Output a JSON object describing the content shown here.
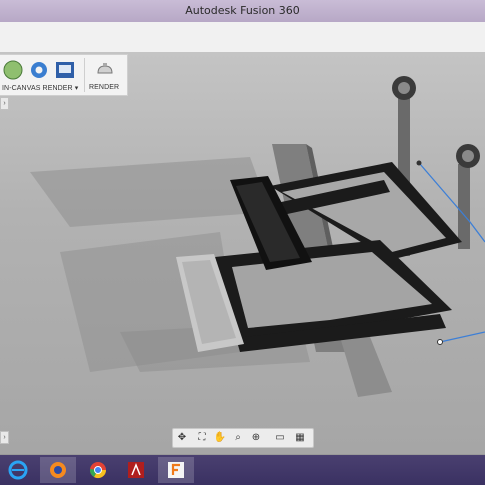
{
  "window": {
    "title": "Autodesk Fusion 360"
  },
  "toolbar": {
    "in_canvas_render_label": "IN-CANVAS RENDER",
    "render_label": "RENDER",
    "dropdown_caret": "▾"
  },
  "navbar": {
    "icons": [
      "orbit-icon",
      "look-at-icon",
      "pan-icon",
      "zoom-icon",
      "fit-icon",
      "display-settings-icon",
      "grid-icon"
    ]
  },
  "taskbar": {
    "apps": [
      "internet-explorer",
      "firefox",
      "chrome",
      "acrobat-reader",
      "fusion-360"
    ]
  },
  "colors": {
    "frame": "#1b1b1b",
    "platform_light": "#bdbdbd",
    "post": "#6c6c6c",
    "accent_line": "#3d7fd6"
  }
}
